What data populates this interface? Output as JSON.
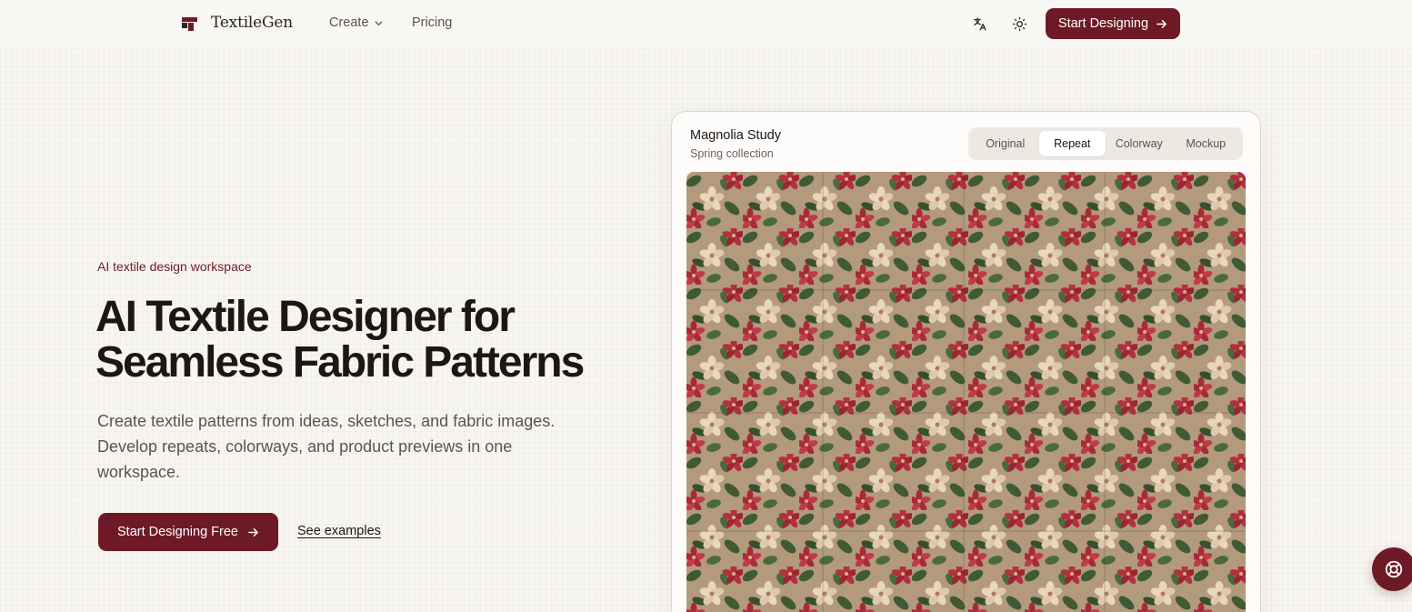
{
  "nav": {
    "brand": "TextileGen",
    "create_label": "Create",
    "pricing_label": "Pricing",
    "cta_label": "Start Designing"
  },
  "hero": {
    "eyebrow": "AI textile design workspace",
    "title_line1": "AI Textile Designer for",
    "title_line2": "Seamless Fabric Patterns",
    "description": "Create textile patterns from ideas, sketches, and fabric images. Develop repeats, colorways, and product previews in one workspace.",
    "cta_label": "Start Designing Free",
    "secondary_label": "See examples"
  },
  "card": {
    "title": "Magnolia Study",
    "subtitle": "Spring collection",
    "tabs": [
      {
        "label": "Original",
        "active": false
      },
      {
        "label": "Repeat",
        "active": true
      },
      {
        "label": "Colorway",
        "active": false
      },
      {
        "label": "Mockup",
        "active": false
      }
    ]
  },
  "colors": {
    "brand": "#6e1a26",
    "background": "#f8f6f1",
    "pattern_ground": "#b39a7c",
    "pattern_leaf": "#3f5a35",
    "pattern_flower_red": "#b2303f",
    "pattern_flower_cream": "#e8d6bd"
  },
  "icons": {
    "translate": "translate-icon",
    "theme": "sun-icon",
    "help": "lifebuoy-icon"
  }
}
